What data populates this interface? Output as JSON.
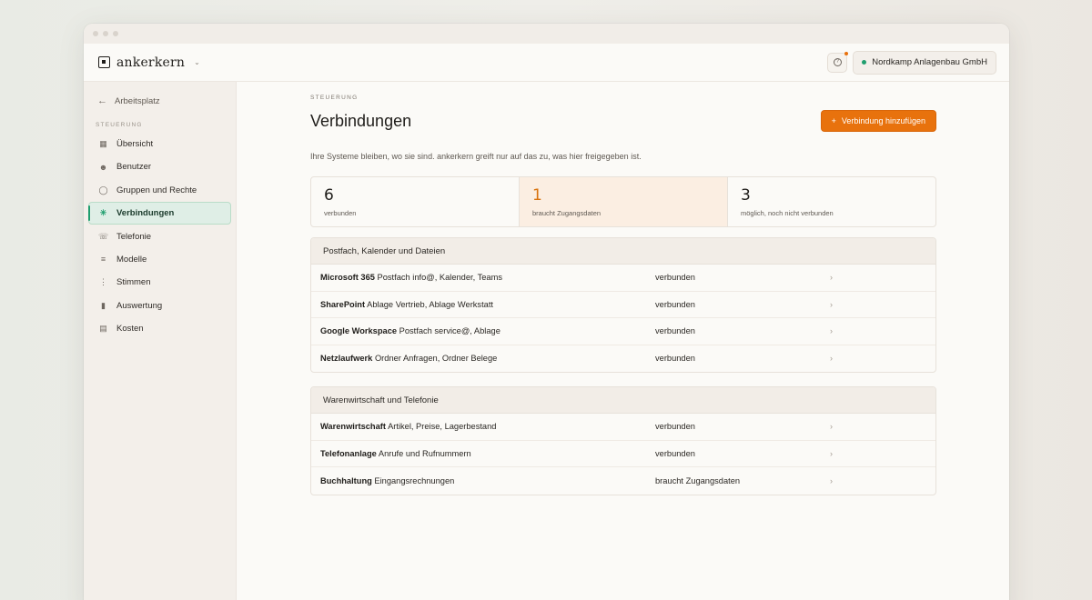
{
  "brand": {
    "name": "ankerkern"
  },
  "org": {
    "name": "Nordkamp Anlagenbau GmbH"
  },
  "sidebar": {
    "back_label": "Arbeitsplatz",
    "section": "STEUERUNG",
    "items": [
      {
        "label": "Übersicht",
        "icon": "grid-icon"
      },
      {
        "label": "Benutzer",
        "icon": "users-icon"
      },
      {
        "label": "Gruppen und Rechte",
        "icon": "shield-icon"
      },
      {
        "label": "Verbindungen",
        "icon": "connections-icon",
        "active": true
      },
      {
        "label": "Telefonie",
        "icon": "phone-icon"
      },
      {
        "label": "Modelle",
        "icon": "sliders-icon"
      },
      {
        "label": "Stimmen",
        "icon": "waveform-icon"
      },
      {
        "label": "Auswertung",
        "icon": "bar-chart-icon"
      },
      {
        "label": "Kosten",
        "icon": "receipt-icon"
      }
    ]
  },
  "main": {
    "eyebrow": "STEUERUNG",
    "title": "Verbindungen",
    "add_button": "Verbindung hinzufügen",
    "subtitle": "Ihre Systeme bleiben, wo sie sind. ankerkern greift nur auf das zu, was hier freigegeben ist."
  },
  "stats": [
    {
      "value": "6",
      "label": "verbunden"
    },
    {
      "value": "1",
      "label": "braucht Zugangsdaten"
    },
    {
      "value": "3",
      "label": "möglich, noch nicht verbunden"
    }
  ],
  "groups": [
    {
      "title": "Postfach, Kalender und Dateien",
      "rows": [
        {
          "name": "Microsoft 365",
          "detail": "Postfach info@, Kalender, Teams",
          "status": "verbunden"
        },
        {
          "name": "SharePoint",
          "detail": "Ablage Vertrieb, Ablage Werkstatt",
          "status": "verbunden"
        },
        {
          "name": "Google Workspace",
          "detail": "Postfach service@, Ablage",
          "status": "verbunden"
        },
        {
          "name": "Netzlaufwerk",
          "detail": "Ordner Anfragen, Ordner Belege",
          "status": "verbunden"
        }
      ]
    },
    {
      "title": "Warenwirtschaft und Telefonie",
      "rows": [
        {
          "name": "Warenwirtschaft",
          "detail": "Artikel, Preise, Lagerbestand",
          "status": "verbunden"
        },
        {
          "name": "Telefonanlage",
          "detail": "Anrufe und Rufnummern",
          "status": "verbunden"
        },
        {
          "name": "Buchhaltung",
          "detail": "Eingangsrechnungen",
          "status": "braucht Zugangsdaten"
        }
      ]
    }
  ]
}
